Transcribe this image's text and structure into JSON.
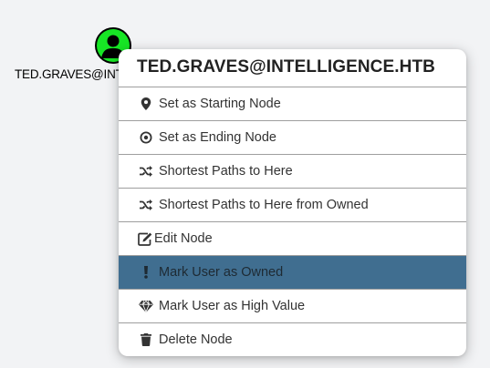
{
  "node": {
    "label": "TED.GRAVES@INTELLIGENCE.HTB",
    "icon": "user-icon",
    "icon_color": "#17e625",
    "bg_color": "#000000"
  },
  "menu": {
    "title": "TED.GRAVES@INTELLIGENCE.HTB",
    "highlight_color": "#406e90",
    "items": [
      {
        "label": "Set as Starting Node",
        "icon": "map-marker-icon"
      },
      {
        "label": "Set as Ending Node",
        "icon": "bullseye-icon"
      },
      {
        "label": "Shortest Paths to Here",
        "icon": "random-icon"
      },
      {
        "label": "Shortest Paths to Here from Owned",
        "icon": "random-icon"
      },
      {
        "label": "Edit Node",
        "icon": "edit-icon"
      },
      {
        "label": "Mark User as Owned",
        "icon": "exclamation-icon",
        "highlighted": true
      },
      {
        "label": "Mark User as High Value",
        "icon": "gem-icon"
      },
      {
        "label": "Delete Node",
        "icon": "trash-icon"
      }
    ]
  }
}
